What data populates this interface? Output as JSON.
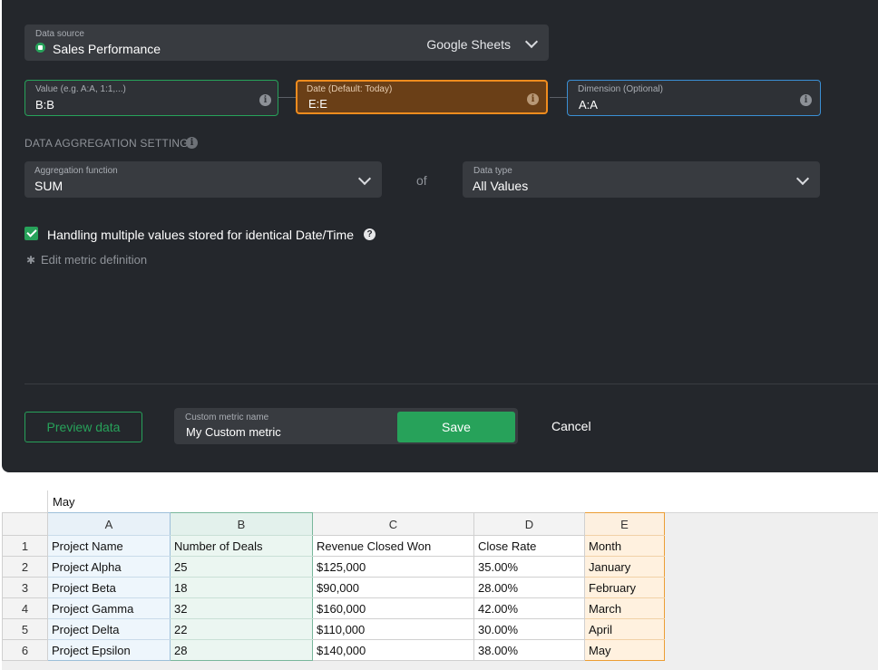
{
  "colors": {
    "panel_bg": "#24272c",
    "field_bg": "#383b40",
    "value_border": "#27a25a",
    "date_border": "#f08c1e",
    "date_bg": "#6a3f17",
    "dimension_border": "#3a8fd4",
    "save_green": "#27a25a"
  },
  "data_source": {
    "label": "Data source",
    "name": "Sales Performance",
    "provider": "Google Sheets"
  },
  "ranges": {
    "value": {
      "label": "Value (e.g. A:A, 1:1,...)",
      "value": "B:B"
    },
    "date": {
      "label": "Date (Default: Today)",
      "value": "E:E"
    },
    "dimension": {
      "label": "Dimension (Optional)",
      "value": "A:A"
    }
  },
  "aggregation": {
    "section_title": "DATA AGGREGATION SETTINGS",
    "function_label": "Aggregation function",
    "function_value": "SUM",
    "of_text": "of",
    "type_label": "Data type",
    "type_value": "All Values"
  },
  "options": {
    "handling_label": "Handling multiple values stored for identical Date/Time",
    "handling_checked": true,
    "edit_link": "Edit metric definition"
  },
  "footer": {
    "preview_button": "Preview data",
    "name_label": "Custom metric name",
    "name_value": "My Custom metric",
    "save_button": "Save",
    "cancel_button": "Cancel"
  },
  "spreadsheet": {
    "formula_value": "May",
    "column_headers": [
      "A",
      "B",
      "C",
      "D",
      "E"
    ],
    "rows": [
      {
        "num": "1",
        "cells": [
          "Project Name",
          "Number of Deals",
          "Revenue Closed Won",
          "Close Rate",
          "Month"
        ]
      },
      {
        "num": "2",
        "cells": [
          "Project Alpha",
          "25",
          "$125,000",
          "35.00%",
          "January"
        ]
      },
      {
        "num": "3",
        "cells": [
          "Project Beta",
          "18",
          "$90,000",
          "28.00%",
          "February"
        ]
      },
      {
        "num": "4",
        "cells": [
          "Project Gamma",
          "32",
          "$160,000",
          "42.00%",
          "March"
        ]
      },
      {
        "num": "5",
        "cells": [
          "Project Delta",
          "22",
          "$110,000",
          "30.00%",
          "April"
        ]
      },
      {
        "num": "6",
        "cells": [
          "Project Epsilon",
          "28",
          "$140,000",
          "38.00%",
          "May"
        ]
      }
    ]
  }
}
